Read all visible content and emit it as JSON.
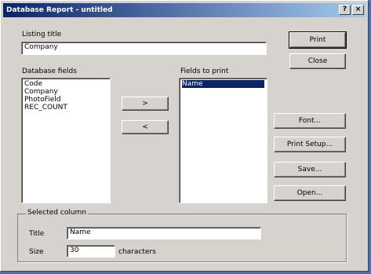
{
  "window": {
    "title": "Database Report - untitled",
    "help_glyph": "?",
    "close_glyph": "×"
  },
  "listing_title": {
    "label": "Listing title",
    "value": "Company"
  },
  "database_fields": {
    "label": "Database fields",
    "items": [
      "Code",
      "Company",
      "PhotoField",
      "REC_COUNT"
    ]
  },
  "move_buttons": {
    "add_label": ">",
    "remove_label": "<"
  },
  "fields_to_print": {
    "label": "Fields to print",
    "items": [
      "Name"
    ]
  },
  "buttons": {
    "print": "Print",
    "close": "Close",
    "font": "Font...",
    "print_setup": "Print Setup...",
    "save": "Save...",
    "open": "Open..."
  },
  "selected_column": {
    "label": "Selected column",
    "title_label": "Title",
    "title_value": "Name",
    "size_label": "Size",
    "size_value": "30",
    "size_unit": "characters"
  }
}
